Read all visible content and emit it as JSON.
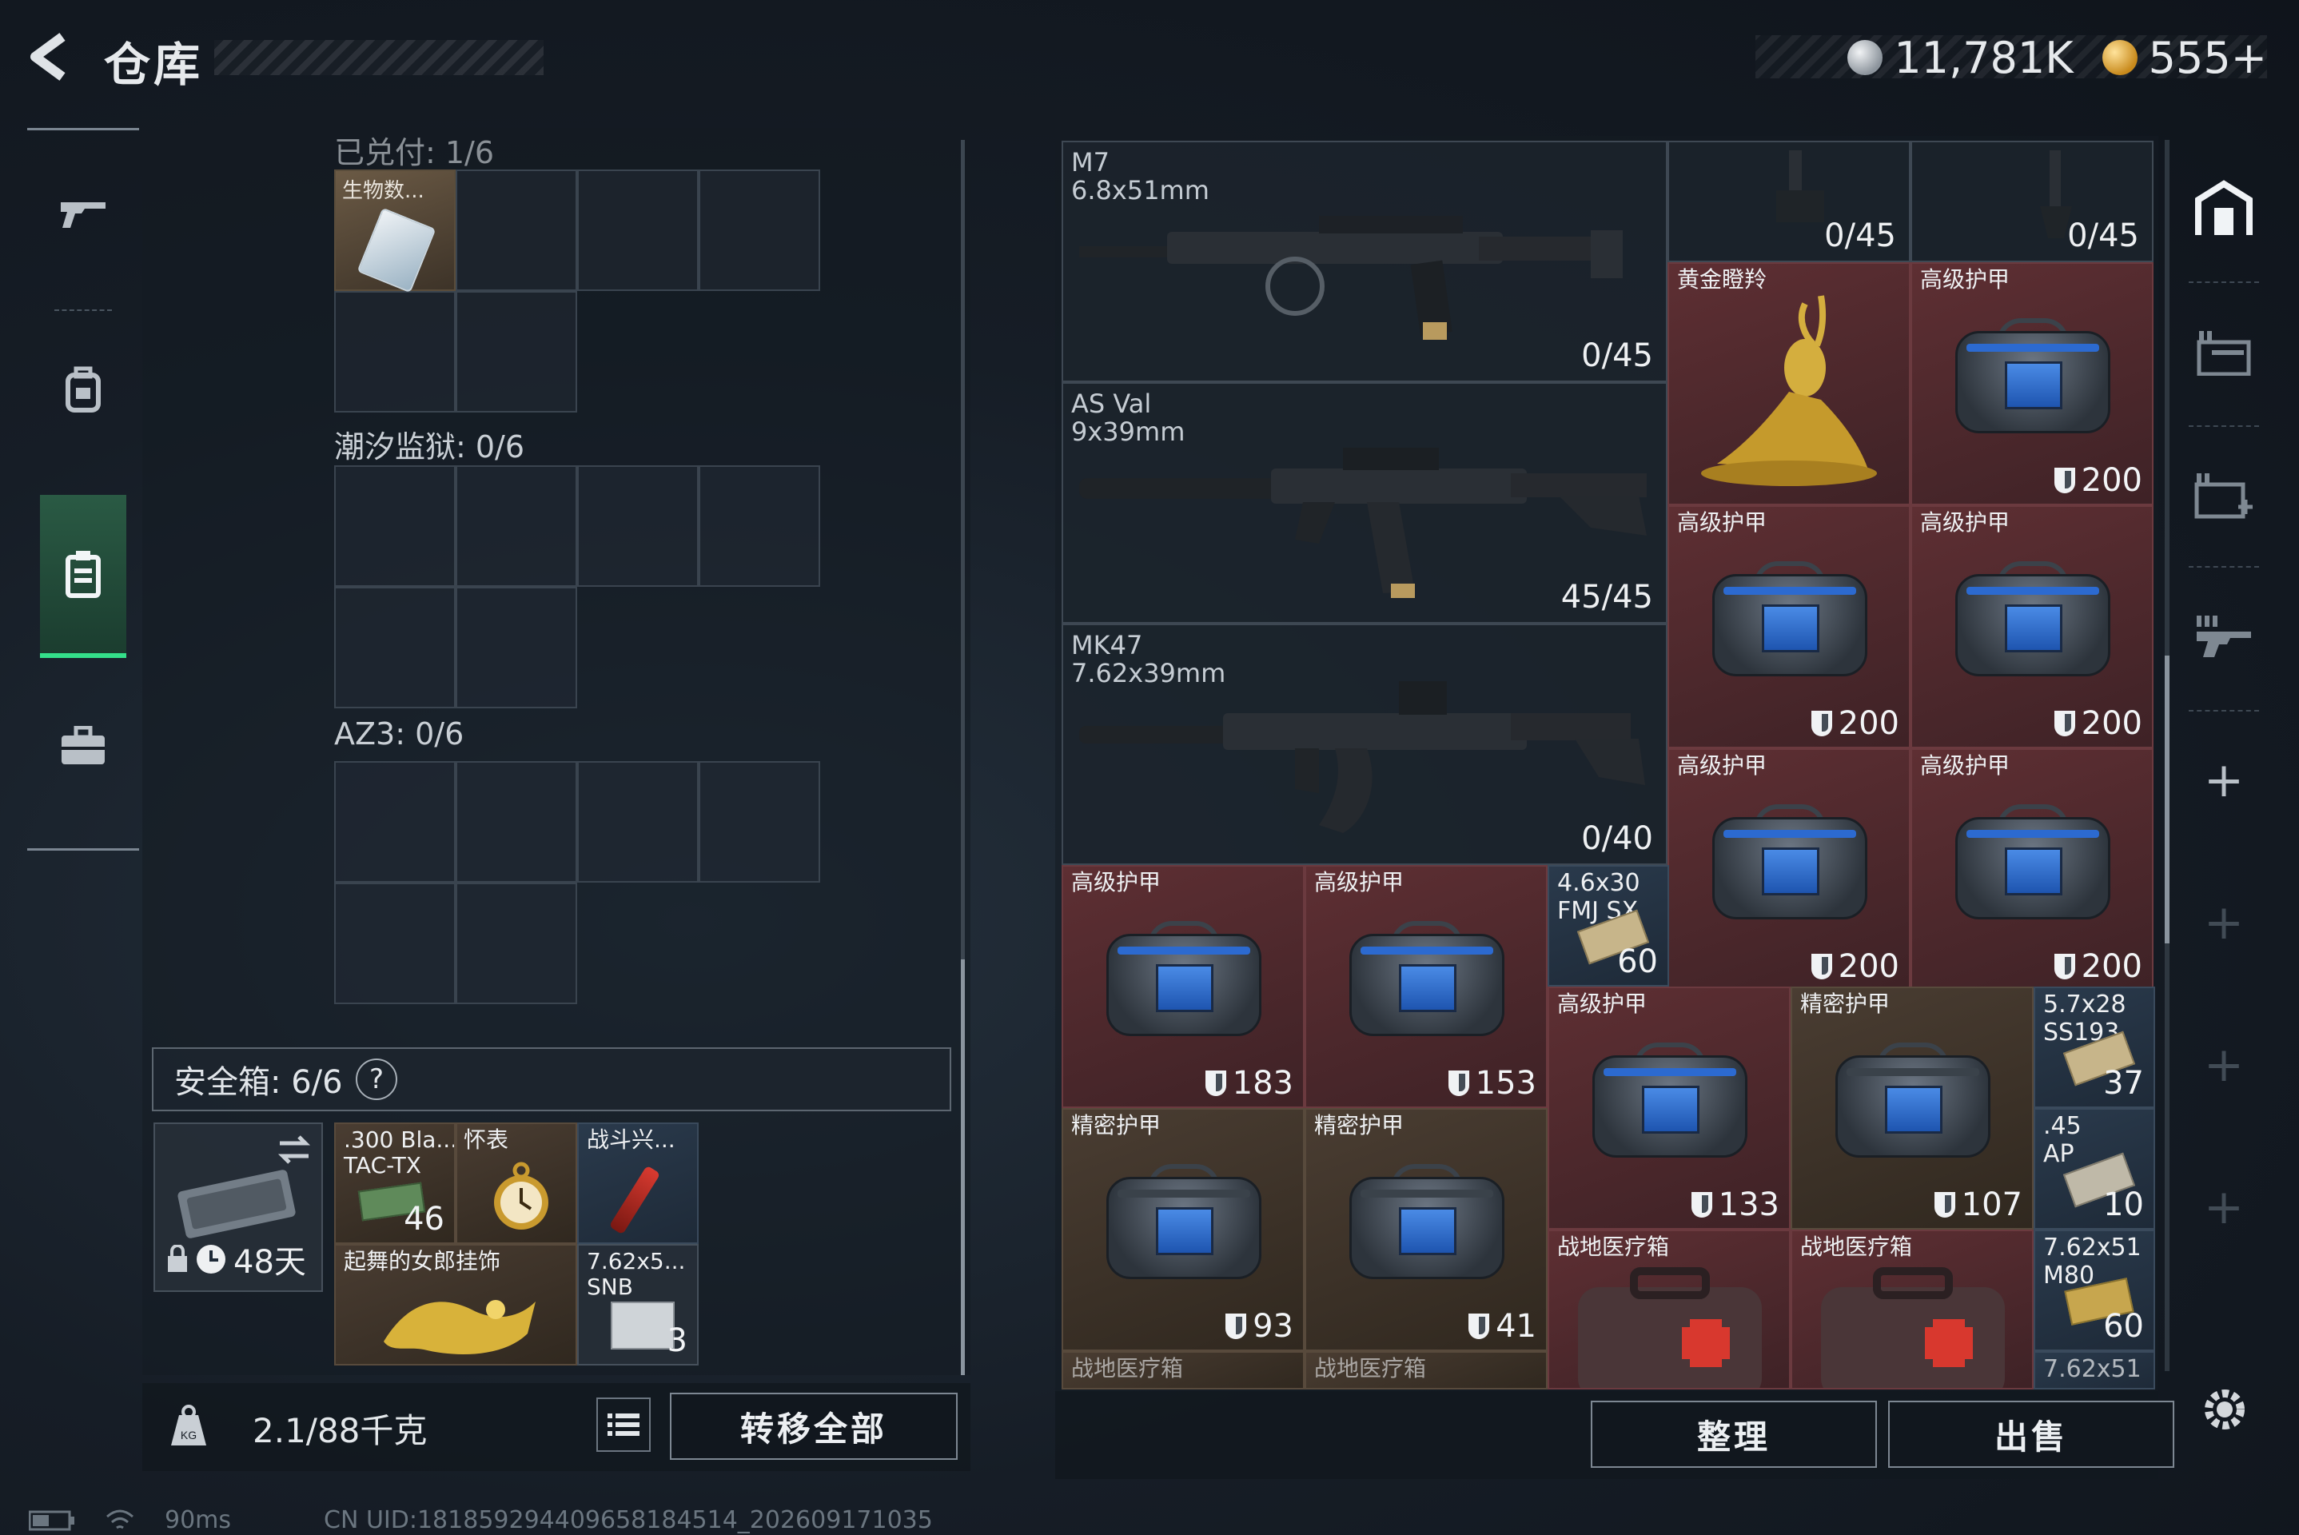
{
  "header": {
    "title": "仓库",
    "currency_silver": "11,781K",
    "currency_gold": "555+"
  },
  "sidebar": {
    "items": [
      {
        "icon": "gun-icon"
      },
      {
        "icon": "backpack-icon"
      },
      {
        "icon": "container-icon",
        "active": true
      },
      {
        "icon": "briefcase-icon"
      }
    ]
  },
  "left": {
    "sections": [
      {
        "label": "已兑付: 1/6",
        "item_label": "生物数..."
      },
      {
        "label": "潮汐监狱: 0/6"
      },
      {
        "label": "AZ3: 0/6"
      }
    ],
    "safebox_label": "安全箱: 6/6",
    "safebox_help": "?",
    "safebox_days": "48天",
    "safe_items": [
      {
        "label": ".300 Bla...\nTAC-TX",
        "count": "46"
      },
      {
        "label": "怀表"
      },
      {
        "label": "战斗兴..."
      },
      {
        "label": "起舞的女郎挂饰"
      },
      {
        "label": "7.62x5...\nSNB",
        "count": "3"
      }
    ],
    "weight": "2.1/88千克",
    "transfer_all": "转移全部"
  },
  "right": {
    "weapons": [
      {
        "name": "M7",
        "ammo": "6.8x51mm",
        "capacity": "0/45"
      },
      {
        "name": "AS Val",
        "ammo": "9x39mm",
        "capacity": "45/45"
      },
      {
        "name": "MK47",
        "ammo": "7.62x39mm",
        "capacity": "0/40"
      }
    ],
    "attach_caps": [
      "0/45",
      "0/45"
    ],
    "items": {
      "deer": "黄金瞪羚",
      "armor_high": "高级护甲",
      "armor_fine": "精密护甲",
      "medkit": "战地医疗箱",
      "ammo1": "4.6x30\nFMJ SX",
      "ammo1_count": "60",
      "ammo2": "5.7x28\nSS193",
      "ammo2_count": "37",
      "ammo3": ".45\nAP",
      "ammo3_count": "10",
      "ammo4": "7.62x51\nM80",
      "ammo4_count": "60",
      "ammo5": "7.62x51"
    },
    "durabilities": {
      "a1": "200",
      "a2": "200",
      "a3": "200",
      "a4": "200",
      "a5": "200",
      "b1": "183",
      "b2": "153",
      "b3": "133",
      "b4": "107",
      "b5": "93",
      "b6": "41"
    },
    "organize": "整理",
    "sell": "出售"
  },
  "footer": {
    "ping": "90ms",
    "uid": "CN UID:18185929440965818451​4_202609171035"
  },
  "colors": {
    "accent_green": "#34e08a",
    "rare_red": "#5e2f33",
    "epic_brown": "#4a3d32"
  }
}
